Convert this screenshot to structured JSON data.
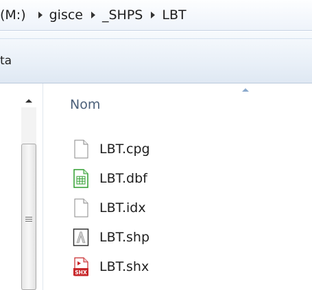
{
  "address_bar": {
    "crumbs": [
      "(M:)",
      "gisce",
      "_SHPS",
      "LBT"
    ]
  },
  "toolbar": {
    "partial_label": "ta"
  },
  "file_list": {
    "column_header": "Nom",
    "files": [
      {
        "name": "LBT.cpg",
        "icon": "generic-file-icon"
      },
      {
        "name": "LBT.dbf",
        "icon": "spreadsheet-file-icon"
      },
      {
        "name": "LBT.idx",
        "icon": "generic-file-icon"
      },
      {
        "name": "LBT.shp",
        "icon": "shapefile-icon"
      },
      {
        "name": "LBT.shx",
        "icon": "shx-file-icon"
      }
    ]
  },
  "colors": {
    "header_text": "#4c607a",
    "toolbar_bg": "#e9f0f8",
    "dbf_icon": "#2e9d2e",
    "shx_icon": "#c8272a"
  }
}
